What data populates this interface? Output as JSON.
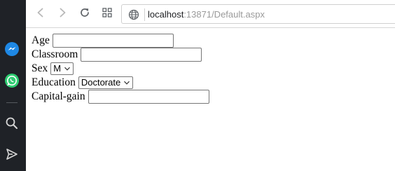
{
  "side_panel": {
    "icons": [
      "messenger-icon",
      "whatsapp-icon",
      "search-icon",
      "send-icon"
    ],
    "colors": {
      "background": "#1f2227",
      "messenger": "#1e88e5",
      "whatsapp": "#2ecc71",
      "icon": "#d6d6d6"
    }
  },
  "toolbar": {
    "back_icon": "chevron-left-icon",
    "forward_icon": "chevron-right-icon",
    "reload_icon": "reload-icon",
    "tabs_icon": "grid-icon"
  },
  "address": {
    "host": "localhost",
    "rest": ":13871/Default.aspx"
  },
  "form": {
    "age": {
      "label": "Age",
      "value": ""
    },
    "classroom": {
      "label": "Classroom",
      "value": ""
    },
    "sex": {
      "label": "Sex",
      "selected": "M"
    },
    "education": {
      "label": "Education",
      "selected": "Doctorate"
    },
    "capital_gain": {
      "label": "Capital-gain",
      "value": ""
    }
  }
}
